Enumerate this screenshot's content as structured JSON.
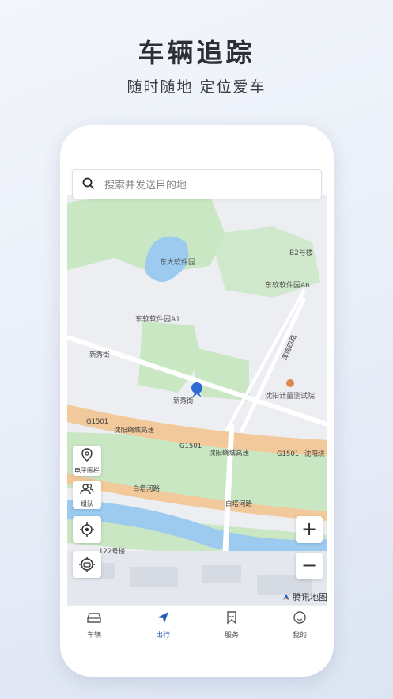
{
  "headline": "车辆追踪",
  "subline": "随时随地 定位爱车",
  "search": {
    "placeholder": "搜索并发送目的地"
  },
  "map": {
    "labels": {
      "b2": "B2号楼",
      "dongda": "东大软件园",
      "a6": "东软软件园A6",
      "a1": "东软软件园A1",
      "xinxiu1": "新秀街",
      "xinxiu2": "新秀街",
      "hunnan": "浑南四路",
      "shenyang_jl": "沈阳计量测试院",
      "g1501_1": "G1501",
      "g1501_2": "G1501",
      "g1501_3": "G1501",
      "ring1": "沈阳绕城高速",
      "ring2": "沈阳绕城高速",
      "ring3": "沈阳绕",
      "baita1": "白塔河路",
      "baita2": "白塔河路",
      "bldg122": "122号楼"
    },
    "tools": {
      "fence": "电子围栏",
      "team": "组队"
    },
    "zoom_in": "+",
    "zoom_out": "−",
    "brand": "腾讯地图"
  },
  "tabs": [
    {
      "label": "车辆",
      "icon": "car-icon"
    },
    {
      "label": "出行",
      "icon": "compass-icon"
    },
    {
      "label": "服务",
      "icon": "bookmark-icon"
    },
    {
      "label": "我的",
      "icon": "face-icon"
    }
  ],
  "colors": {
    "accent": "#2a5fb8",
    "green": "#c9e7c3",
    "highway": "#f2c99a",
    "water": "#9ccbef"
  }
}
